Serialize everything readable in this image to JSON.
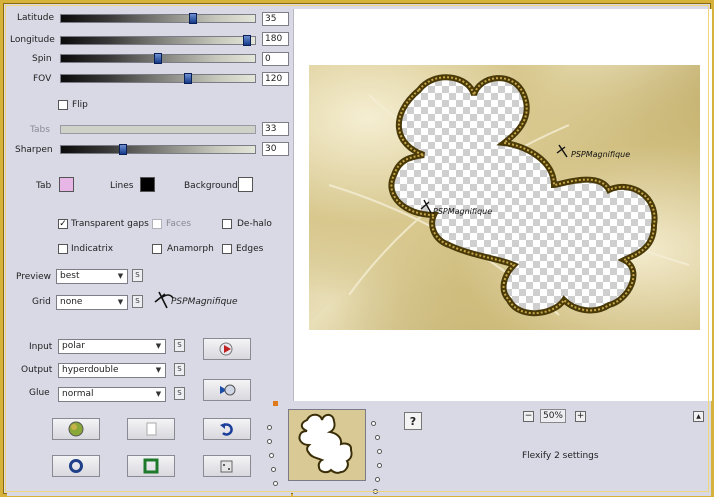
{
  "params": {
    "latitude": {
      "label": "Latitude",
      "value": "35",
      "fraction": 0.69
    },
    "longitude": {
      "label": "Longitude",
      "value": "180",
      "fraction": 0.98
    },
    "spin": {
      "label": "Spin",
      "value": "0",
      "fraction": 0.5
    },
    "fov": {
      "label": "FOV",
      "value": "120",
      "fraction": 0.66
    },
    "flip": {
      "label": "Flip",
      "checked": false
    },
    "tabs": {
      "label": "Tabs",
      "value": "33"
    },
    "sharpen": {
      "label": "Sharpen",
      "value": "30",
      "fraction": 0.31
    }
  },
  "colors": {
    "tab": {
      "label": "Tab",
      "color": "#e8b6e6"
    },
    "lines": {
      "label": "Lines",
      "color": "#000000"
    },
    "background": {
      "label": "Background",
      "color": "#ffffff"
    }
  },
  "options": {
    "transparent_gaps": {
      "label": "Transparent gaps",
      "checked": true
    },
    "faces": {
      "label": "Faces",
      "checked": false,
      "disabled": true
    },
    "de_halo": {
      "label": "De-halo",
      "checked": false
    },
    "indicatrix": {
      "label": "Indicatrix",
      "checked": false
    },
    "anamorph": {
      "label": "Anamorph",
      "checked": false
    },
    "edges": {
      "label": "Edges",
      "checked": false
    }
  },
  "selects": {
    "preview": {
      "label": "Preview",
      "value": "best"
    },
    "grid": {
      "label": "Grid",
      "value": "none"
    },
    "input": {
      "label": "Input",
      "value": "polar"
    },
    "output": {
      "label": "Output",
      "value": "hyperdouble"
    },
    "glue": {
      "label": "Glue",
      "value": "normal"
    },
    "s_label": "S"
  },
  "watermark": "PSPMagnifique",
  "zoom": {
    "minus": "−",
    "value": "50%",
    "plus": "+"
  },
  "help": "?",
  "scroll_up": "▲",
  "status": "Flexify 2 settings"
}
